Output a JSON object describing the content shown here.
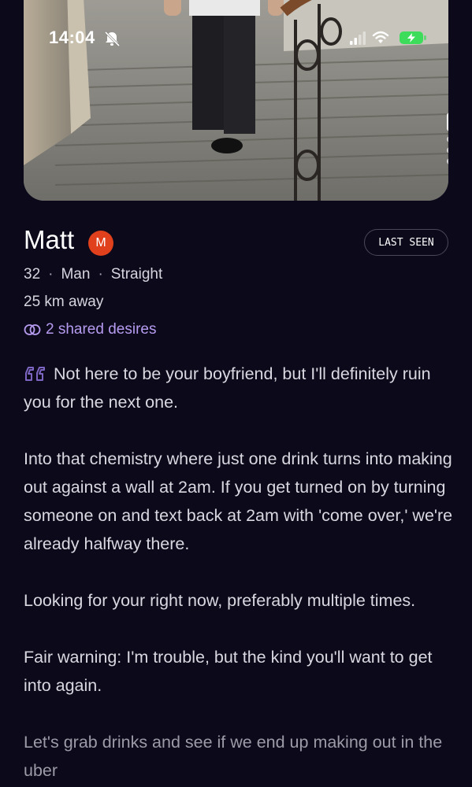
{
  "status_bar": {
    "time": "14:04"
  },
  "photo": {
    "description_icon": "photo-icon",
    "pager": {
      "count": 4,
      "active_index": 0
    }
  },
  "profile": {
    "name": "Matt",
    "badge": "M",
    "last_seen_label": "LAST SEEN",
    "age": "32",
    "gender": "Man",
    "orientation": "Straight",
    "separator": "·",
    "distance": "25 km away",
    "shared_desires": "2 shared desires"
  },
  "bio": {
    "paragraphs": [
      "Not here to be your boyfriend, but I'll definitely ruin you for the next one.",
      "Into that chemistry where just one drink turns into making out against a wall at 2am. If you get turned on by turning someone on and text back at 2am with 'come over,' we're already halfway there.",
      "Looking for your right now, preferably multiple times.",
      "Fair warning: I'm trouble, but the kind you'll want to get into again.",
      "Let's grab drinks and see if we end up making out in the uber"
    ]
  },
  "colors": {
    "background": "#0c0a1a",
    "badge": "#e0401c",
    "accent": "#b69bf0",
    "battery": "#3ddc5a"
  }
}
